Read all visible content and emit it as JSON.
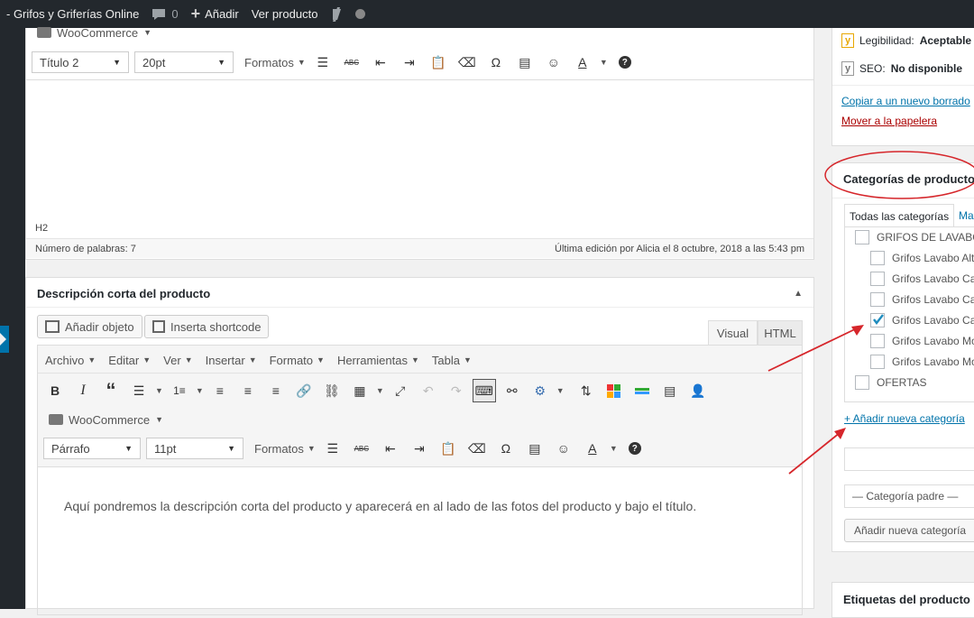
{
  "adminbar": {
    "site": "- Grifos y Griferías Online",
    "comments_count": "0",
    "add_label": "Añadir",
    "view_label": "Ver producto"
  },
  "editor1": {
    "plugin_label": "WooCommerce",
    "heading_select": "Título 2",
    "size_select": "20pt",
    "formats_label": "Formatos",
    "path": "H2",
    "word_count": "Número de palabras: 7",
    "last_edit": "Última edición por Alicia el 8 octubre, 2018 a las 5:43 pm"
  },
  "short_desc": {
    "title": "Descripción corta del producto",
    "add_object": "Añadir objeto",
    "shortcode": "Inserta shortcode",
    "tab_visual": "Visual",
    "tab_html": "HTML",
    "menu": [
      "Archivo",
      "Editar",
      "Ver",
      "Insertar",
      "Formato",
      "Herramientas",
      "Tabla"
    ],
    "plugin_label": "WooCommerce",
    "para_select": "Párrafo",
    "size_select": "11pt",
    "formats_label": "Formatos",
    "content": "Aquí pondremos la descripción corta del producto y aparecerá en al lado de las fotos del producto y bajo el título."
  },
  "sidebar": {
    "readability_label": "Legibilidad:",
    "readability_value": "Aceptable",
    "seo_label": "SEO:",
    "seo_value": "No disponible",
    "copy_link": "Copiar a un nuevo borrado",
    "trash_link": "Mover a la papelera",
    "categories_title": "Categorías de producto",
    "tab_all": "Todas las categorías",
    "tab_more": "Ma",
    "categories": [
      {
        "label": "GRIFOS DE LAVABO",
        "checked": false,
        "child": false
      },
      {
        "label": "Grifos Lavabo Alt",
        "checked": false,
        "child": true
      },
      {
        "label": "Grifos Lavabo Ca",
        "checked": false,
        "child": true
      },
      {
        "label": "Grifos Lavabo Ca",
        "checked": false,
        "child": true
      },
      {
        "label": "Grifos Lavabo Ca",
        "checked": true,
        "child": true
      },
      {
        "label": "Grifos Lavabo Mo",
        "checked": false,
        "child": true
      },
      {
        "label": "Grifos Lavabo Mo",
        "checked": false,
        "child": true
      },
      {
        "label": "OFERTAS",
        "checked": false,
        "child": false
      }
    ],
    "add_category_link": "+ Añadir nueva categoría",
    "parent_select": "— Categoría padre —",
    "add_category_button": "Añadir nueva categoría",
    "tags_title": "Etiquetas del producto"
  },
  "colors": {
    "accent": "#0073aa",
    "annotation": "#d6262b",
    "delete": "#aa0000"
  }
}
